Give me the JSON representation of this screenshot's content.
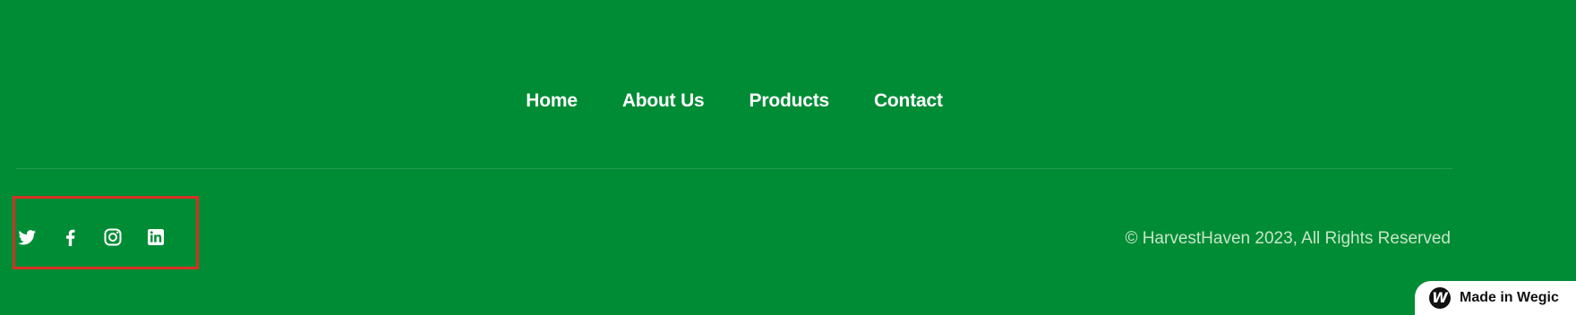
{
  "footer": {
    "nav": [
      {
        "label": "Home"
      },
      {
        "label": "About Us"
      },
      {
        "label": "Products"
      },
      {
        "label": "Contact"
      }
    ],
    "social": [
      {
        "icon": "twitter-icon"
      },
      {
        "icon": "facebook-icon"
      },
      {
        "icon": "instagram-icon"
      },
      {
        "icon": "linkedin-icon"
      }
    ],
    "copyright": "© HarvestHaven 2023, All Rights Reserved"
  },
  "badge": {
    "label": "Made in Wegic"
  },
  "colors": {
    "background": "#008c35",
    "text": "#ffffff",
    "muted_text": "#c7e6c9",
    "highlight_border": "#d83024"
  }
}
